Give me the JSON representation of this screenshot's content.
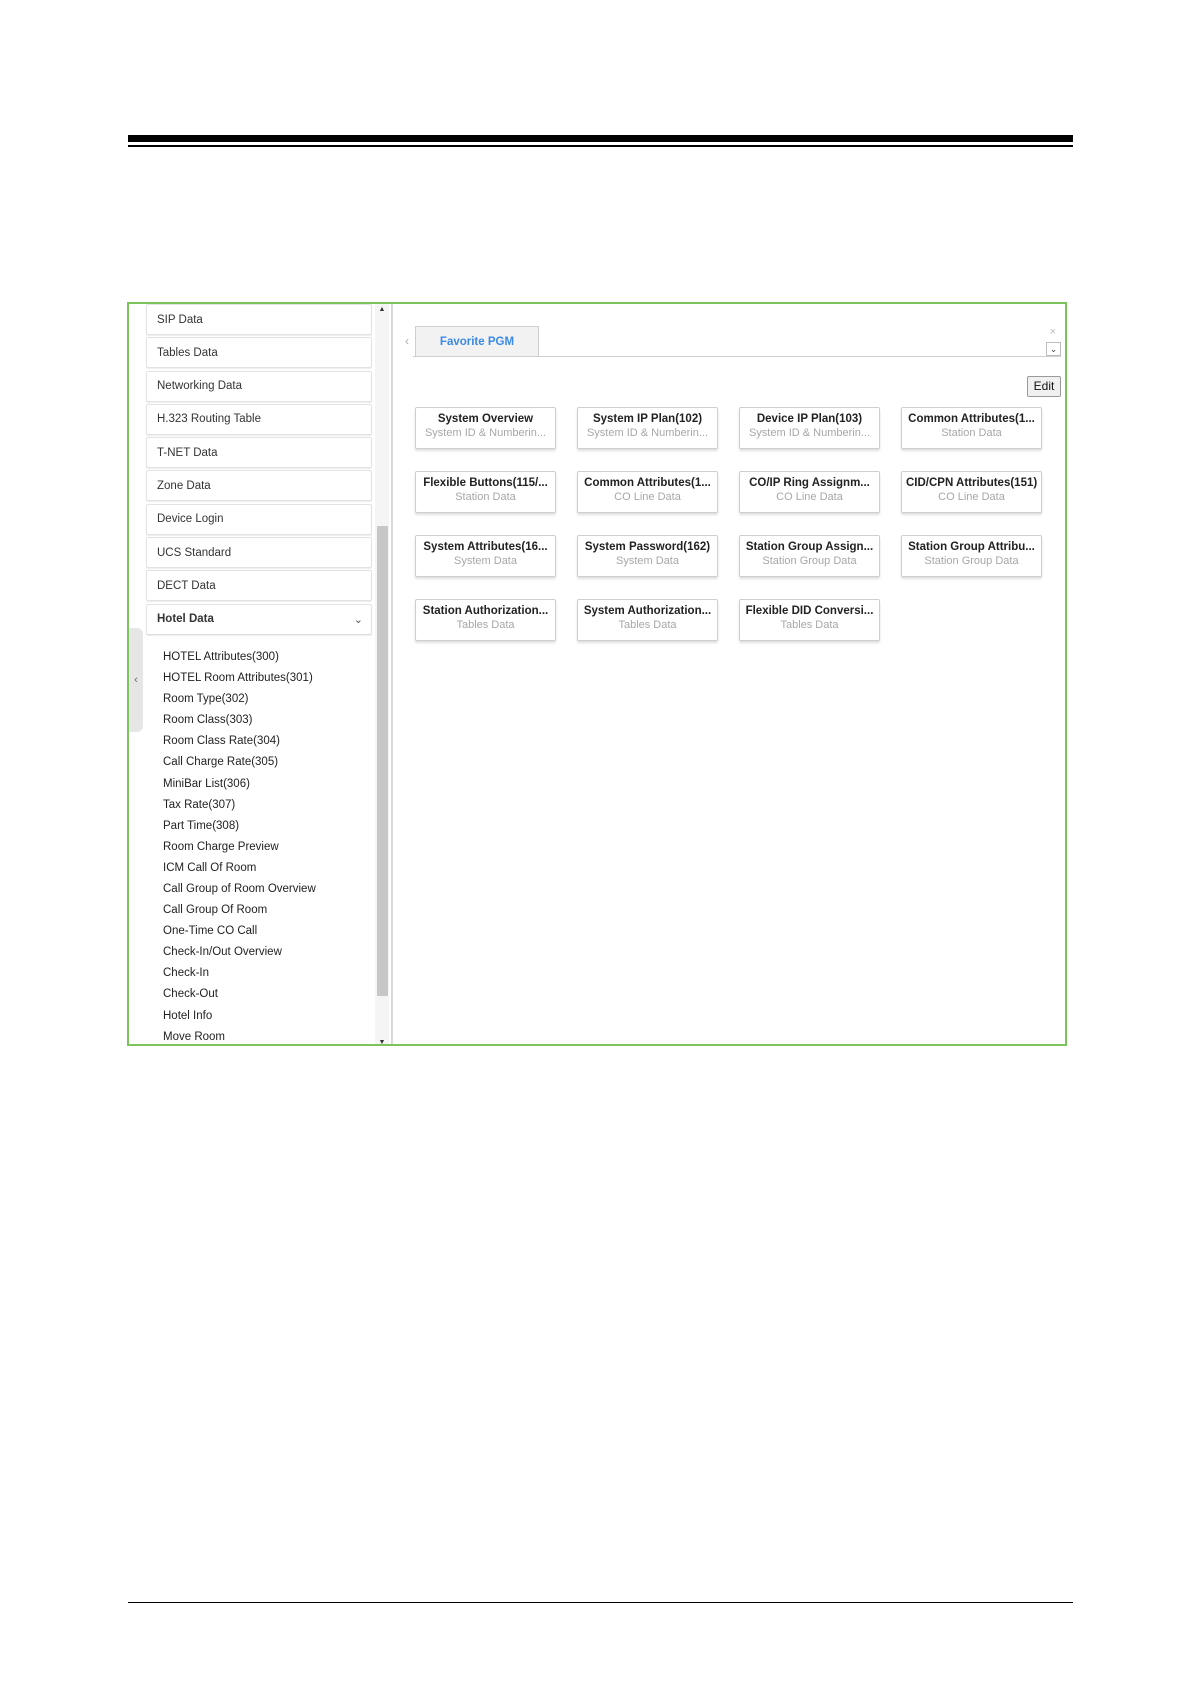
{
  "nav": {
    "items": [
      {
        "label": "SIP Data"
      },
      {
        "label": "Tables Data"
      },
      {
        "label": "Networking Data"
      },
      {
        "label": "H.323 Routing Table"
      },
      {
        "label": "T-NET Data"
      },
      {
        "label": "Zone Data"
      },
      {
        "label": "Device Login"
      },
      {
        "label": "UCS Standard"
      },
      {
        "label": "DECT Data"
      }
    ],
    "expanded": {
      "label": "Hotel Data",
      "children": [
        "HOTEL Attributes(300)",
        "HOTEL Room Attributes(301)",
        "Room Type(302)",
        "Room Class(303)",
        "Room Class Rate(304)",
        "Call Charge Rate(305)",
        "MiniBar List(306)",
        "Tax Rate(307)",
        "Part Time(308)",
        "Room Charge Preview",
        "ICM Call Of Room",
        "Call Group of Room Overview",
        "Call Group Of Room",
        "One-Time CO Call",
        "Check-In/Out Overview",
        "Check-In",
        "Check-Out",
        "Hotel Info",
        "Move Room"
      ]
    }
  },
  "tabs": {
    "active_label": "Favorite PGM"
  },
  "toolbar": {
    "edit_label": "Edit"
  },
  "cards": [
    {
      "title": "System Overview",
      "subtitle": "System ID & Numberin..."
    },
    {
      "title": "System IP Plan(102)",
      "subtitle": "System ID & Numberin..."
    },
    {
      "title": "Device IP Plan(103)",
      "subtitle": "System ID & Numberin..."
    },
    {
      "title": "Common Attributes(1...",
      "subtitle": "Station Data"
    },
    {
      "title": "Flexible Buttons(115/...",
      "subtitle": "Station Data"
    },
    {
      "title": "Common Attributes(1...",
      "subtitle": "CO Line Data"
    },
    {
      "title": "CO/IP Ring Assignm...",
      "subtitle": "CO Line Data"
    },
    {
      "title": "CID/CPN Attributes(151)",
      "subtitle": "CO Line Data"
    },
    {
      "title": "System Attributes(16...",
      "subtitle": "System Data"
    },
    {
      "title": "System Password(162)",
      "subtitle": "System Data"
    },
    {
      "title": "Station Group Assign...",
      "subtitle": "Station Group Data"
    },
    {
      "title": "Station Group Attribu...",
      "subtitle": "Station Group Data"
    },
    {
      "title": "Station Authorization...",
      "subtitle": "Tables Data"
    },
    {
      "title": "System Authorization...",
      "subtitle": "Tables Data"
    },
    {
      "title": "Flexible DID Conversi...",
      "subtitle": "Tables Data"
    }
  ],
  "colors": {
    "frame_border": "#7dc35b",
    "tab_text": "#3b8ae6"
  }
}
